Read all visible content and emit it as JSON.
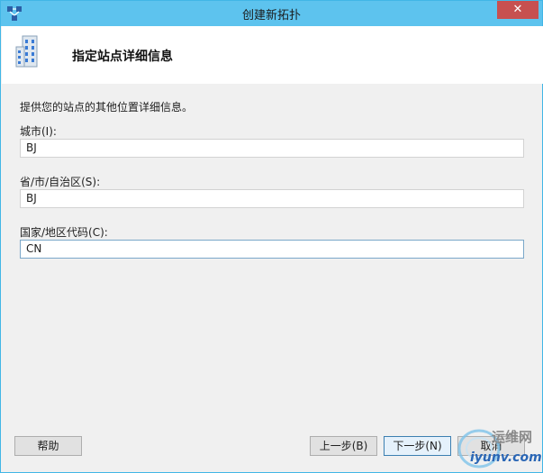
{
  "window": {
    "title": "创建新拓扑",
    "close_glyph": "✕"
  },
  "header": {
    "title": "指定站点详细信息"
  },
  "form": {
    "description": "提供您的站点的其他位置详细信息。",
    "city": {
      "label": "城市(I):",
      "value": "BJ"
    },
    "state": {
      "label": "省/市/自治区(S):",
      "value": "BJ"
    },
    "country": {
      "label": "国家/地区代码(C):",
      "value": "CN"
    }
  },
  "buttons": {
    "help": "帮助",
    "back": "上一步(B)",
    "next": "下一步(N)",
    "cancel": "取消"
  },
  "watermark": {
    "text1": "运维网",
    "text2": "iyunv.com"
  },
  "colors": {
    "titlebar": "#5dc3ee",
    "close": "#c75050",
    "body": "#f0f0f0"
  }
}
